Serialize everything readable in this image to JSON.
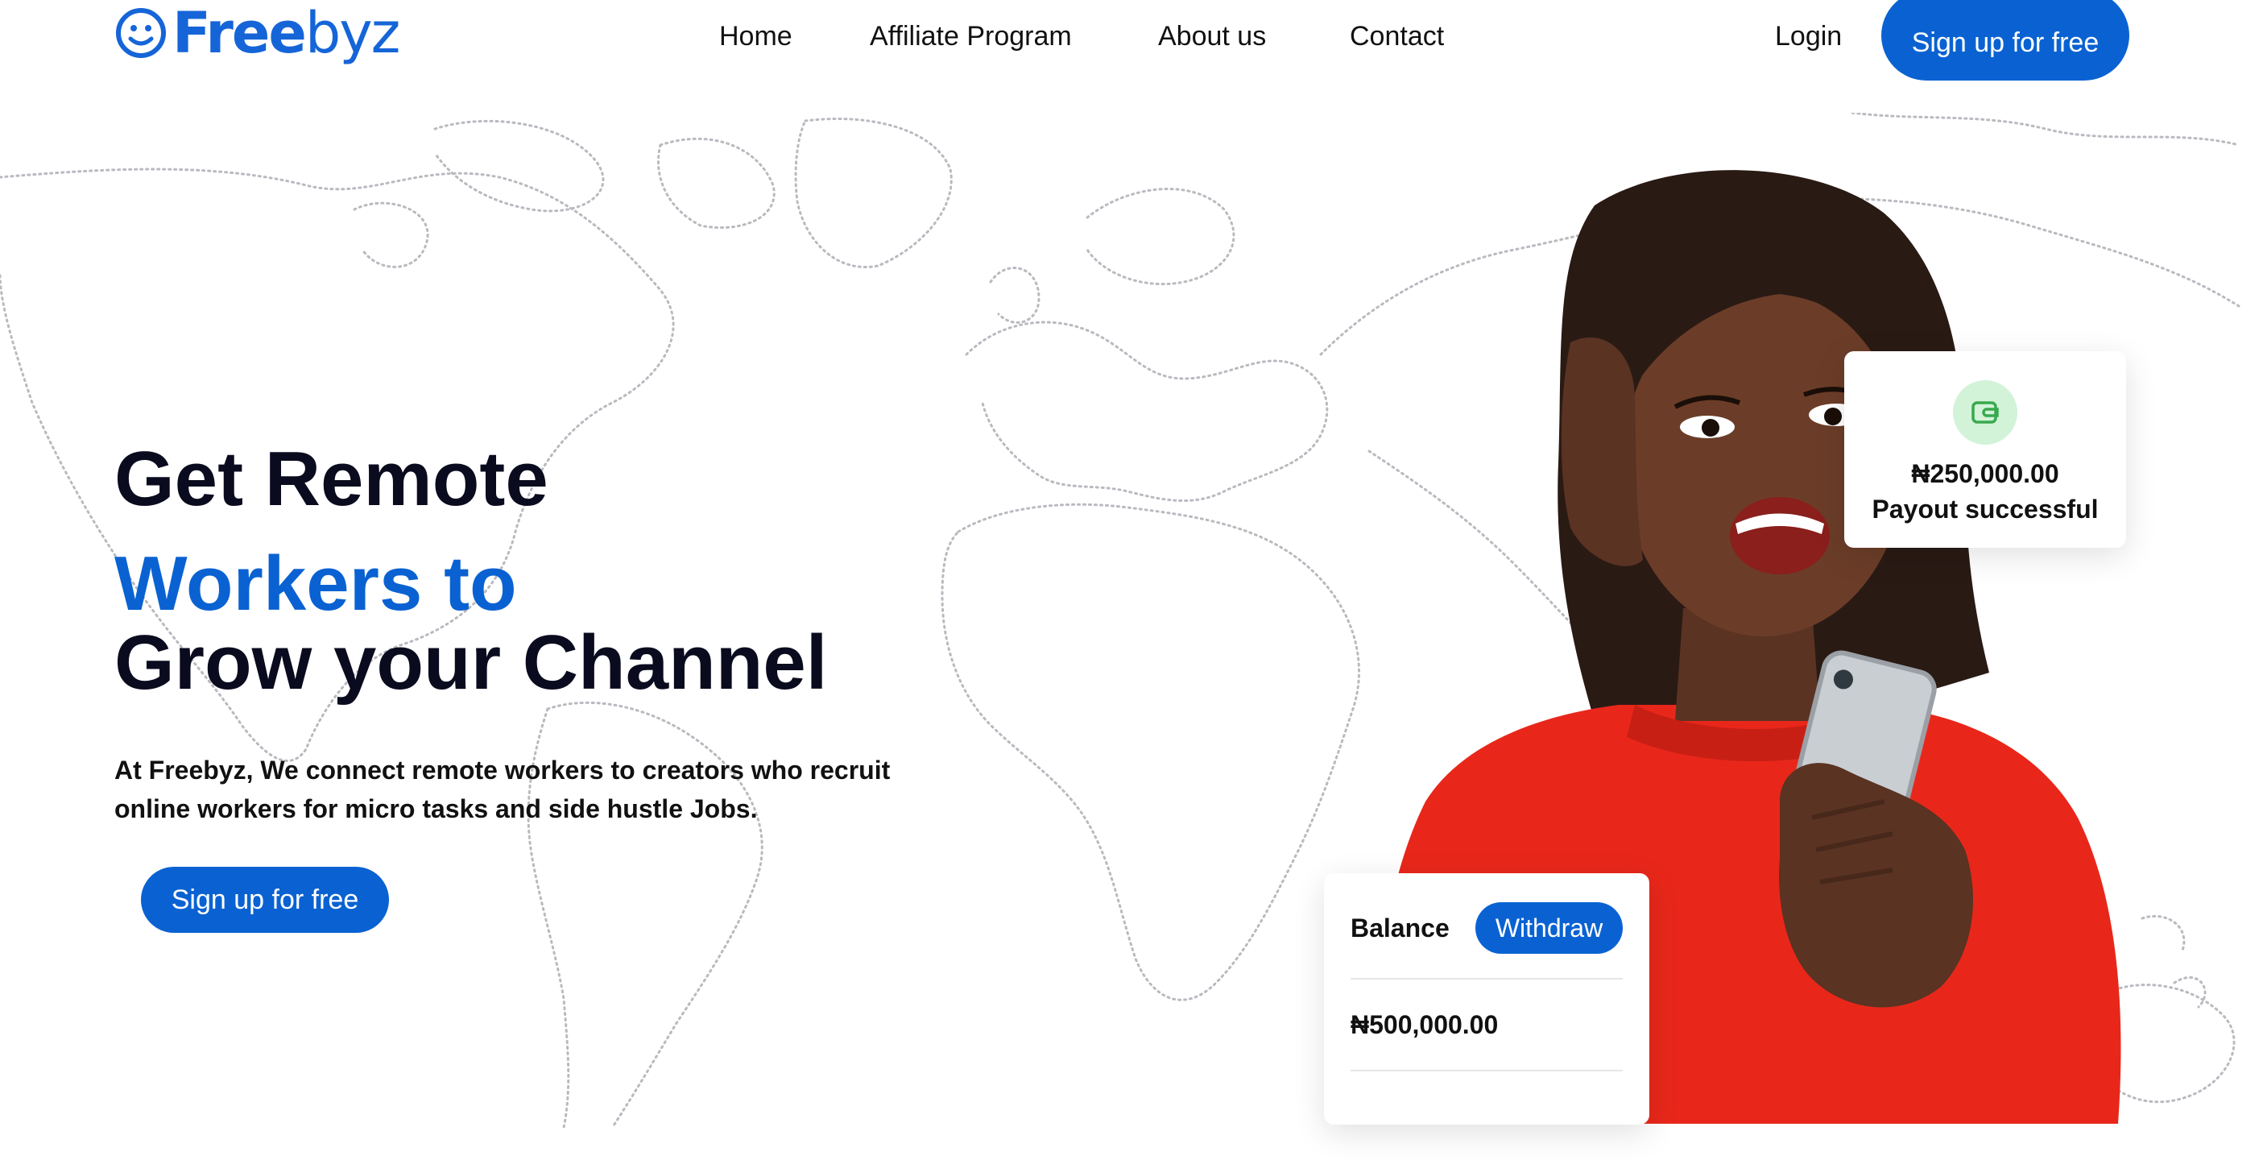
{
  "brand": {
    "name_bold": "Free",
    "name_light": "byz",
    "accent_color": "#0a62d2",
    "logo_icon": "smiley-face-icon"
  },
  "nav": {
    "items": [
      {
        "label": "Home"
      },
      {
        "label": "Affiliate Program"
      },
      {
        "label": "About us"
      },
      {
        "label": "Contact"
      }
    ],
    "login_label": "Login",
    "signup_label": "Sign up for free"
  },
  "hero": {
    "line1": "Get Remote",
    "line2": "Workers to",
    "line3": "Grow your Channel",
    "description": "At Freebyz, We connect remote workers to creators who recruit online workers for micro tasks and side hustle Jobs.",
    "cta_label": "Sign up for free"
  },
  "payout_card": {
    "icon": "wallet-icon",
    "amount": "₦250,000.00",
    "status": "Payout successful"
  },
  "balance_card": {
    "label": "Balance",
    "withdraw_label": "Withdraw",
    "amount": "₦500,000.00"
  }
}
